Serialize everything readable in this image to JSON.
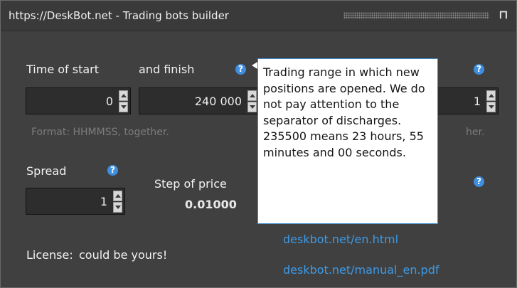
{
  "window": {
    "title": "https://DeskBot.net - Trading bots builder",
    "pin_glyph": "⁠Π"
  },
  "time": {
    "label_start": "Time of start",
    "label_finish": "and finish",
    "start_value": "0",
    "finish_value": "240 000",
    "hint": "Format: HHMMSS, together.",
    "right_value_partial": "1",
    "right_hint_partial": "her."
  },
  "spread": {
    "label": "Spread",
    "value": "1"
  },
  "price_step": {
    "label": "Step of price",
    "value": "0.01000"
  },
  "license": {
    "label": "License:",
    "value": "could be yours!"
  },
  "links": {
    "site": "deskbot.net/en.html",
    "manual": "deskbot.net/manual_en.pdf"
  },
  "help_glyph": "?",
  "tooltip": {
    "text": "Trading range in which new positions are opened. We do not pay attention to the separator of discharges. 235500 means 23 hours, 55 minutes and 00 seconds."
  },
  "colors": {
    "panel_bg": "#404040",
    "accent_link": "#3c9be8",
    "help_icon": "#3f8fe0",
    "tooltip_border": "#3d8fd1"
  }
}
